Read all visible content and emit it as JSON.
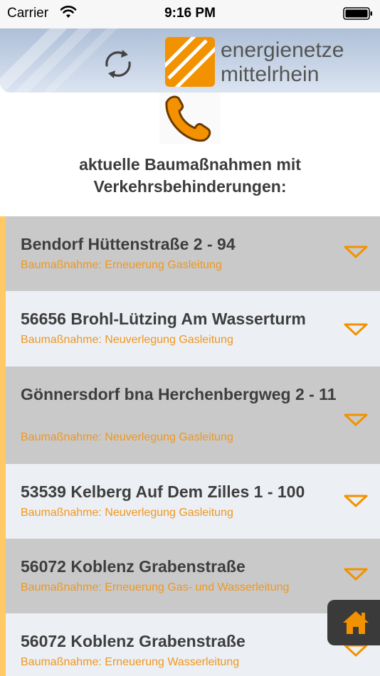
{
  "status_bar": {
    "carrier": "Carrier",
    "time": "9:16 PM"
  },
  "header": {
    "brand_line1": "energienetze",
    "brand_line2": "mittelrhein",
    "refresh_icon": "refresh-cycle-icon",
    "logo_icon": "brand-stripes-logo"
  },
  "phone": {
    "icon": "phone-handset-icon"
  },
  "headline": {
    "line1": "aktuelle Baumaßnahmen mit",
    "line2": "Verkehrsbehinderungen:"
  },
  "items": [
    {
      "title": "Bendorf Hüttenstraße 2 - 94",
      "subtitle": "Baumaßnahme: Erneuerung Gasleitung"
    },
    {
      "title": "56656 Brohl-Lützing Am Wasserturm",
      "subtitle": "Baumaßnahme: Neuverlegung Gasleitung"
    },
    {
      "title": "Gönnersdorf bna Herchenbergweg 2 - 11",
      "subtitle": "Baumaßnahme: Neuverlegung Gasleitung"
    },
    {
      "title": "53539 Kelberg Auf Dem Zilles 1 - 100",
      "subtitle": "Baumaßnahme: Neuverlegung Gasleitung"
    },
    {
      "title": "56072 Koblenz Grabenstraße",
      "subtitle": "Baumaßnahme: Erneuerung Gas- und Wasserleitung"
    },
    {
      "title": "56072 Koblenz Grabenstraße",
      "subtitle": "Baumaßnahme: Erneuerung Wasserleitung"
    }
  ],
  "colors": {
    "accent_orange": "#f0971d",
    "row_dark": "#c9c9c9",
    "row_light": "#eceff4",
    "list_accent": "#ffc966"
  }
}
